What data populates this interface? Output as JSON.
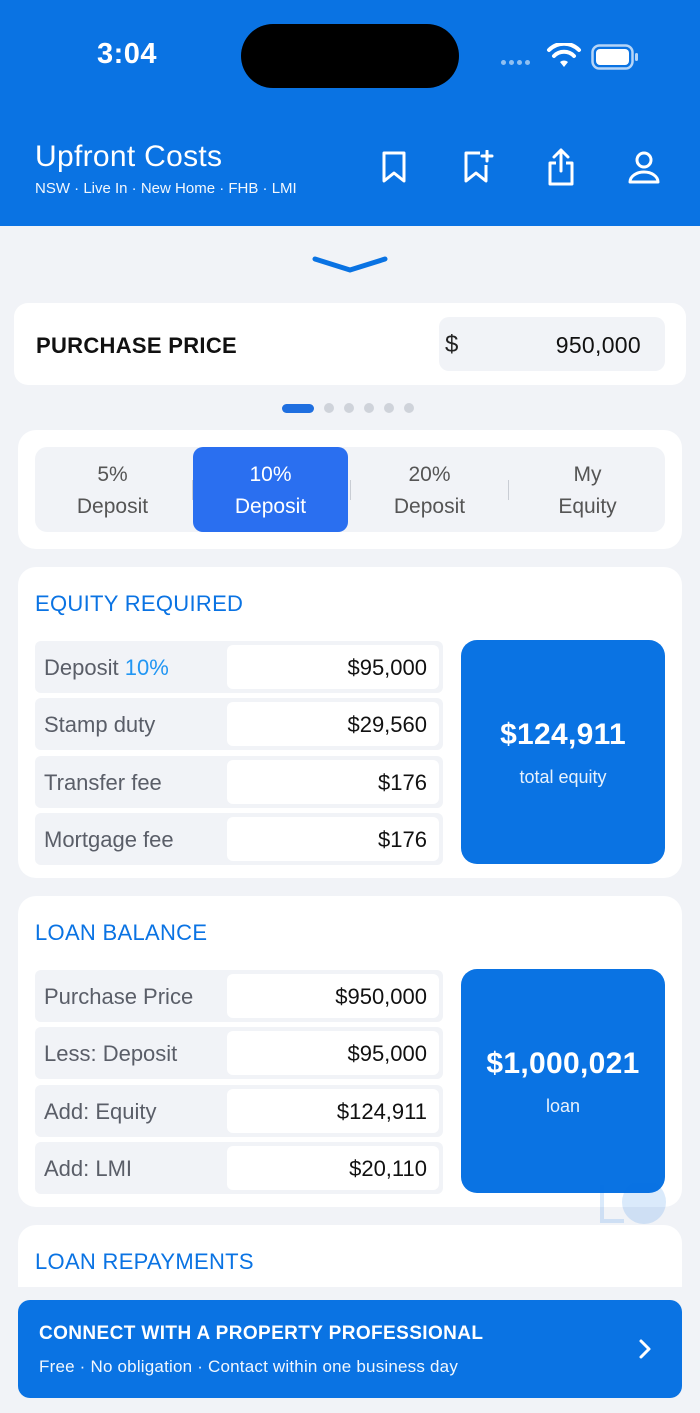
{
  "status_bar": {
    "time": "3:04"
  },
  "header": {
    "title": "Upfront Costs",
    "subtitle": "NSW · Live In · New Home · FHB · LMI",
    "icons": [
      "bookmark-icon",
      "bookmark-add-icon",
      "share-icon",
      "profile-icon"
    ]
  },
  "purchase": {
    "label": "PURCHASE PRICE",
    "currency": "$",
    "value": "950,000"
  },
  "pager": {
    "pages": 6,
    "active": 0
  },
  "deposit_tabs": [
    {
      "line1": "5%",
      "line2": "Deposit",
      "active": false
    },
    {
      "line1": "10%",
      "line2": "Deposit",
      "active": true
    },
    {
      "line1": "20%",
      "line2": "Deposit",
      "active": false
    },
    {
      "line1": "My",
      "line2": "Equity",
      "active": false
    }
  ],
  "equity": {
    "title": "EQUITY REQUIRED",
    "rows": [
      {
        "label": "Deposit",
        "pct": "10%",
        "value": "$95,000"
      },
      {
        "label": "Stamp duty",
        "value": "$29,560"
      },
      {
        "label": "Transfer fee",
        "value": "$176"
      },
      {
        "label": "Mortgage fee",
        "value": "$176"
      }
    ],
    "total_value": "$124,911",
    "total_caption": "total equity"
  },
  "loan": {
    "title": "LOAN BALANCE",
    "rows": [
      {
        "label": "Purchase Price",
        "value": "$950,000"
      },
      {
        "label": "Less: Deposit",
        "value": "$95,000"
      },
      {
        "label": "Add: Equity",
        "value": "$124,911"
      },
      {
        "label": "Add: LMI",
        "value": "$20,110"
      }
    ],
    "total_value": "$1,000,021",
    "total_caption": "loan"
  },
  "repayments": {
    "title": "LOAN REPAYMENTS"
  },
  "cta": {
    "title": "CONNECT WITH A PROPERTY PROFESSIONAL",
    "subtitle": "Free · No obligation · Contact within one business day"
  },
  "colors": {
    "brand": "#0a73e3",
    "active_tab": "#2a6ff0",
    "accent_pct": "#2196f3"
  }
}
